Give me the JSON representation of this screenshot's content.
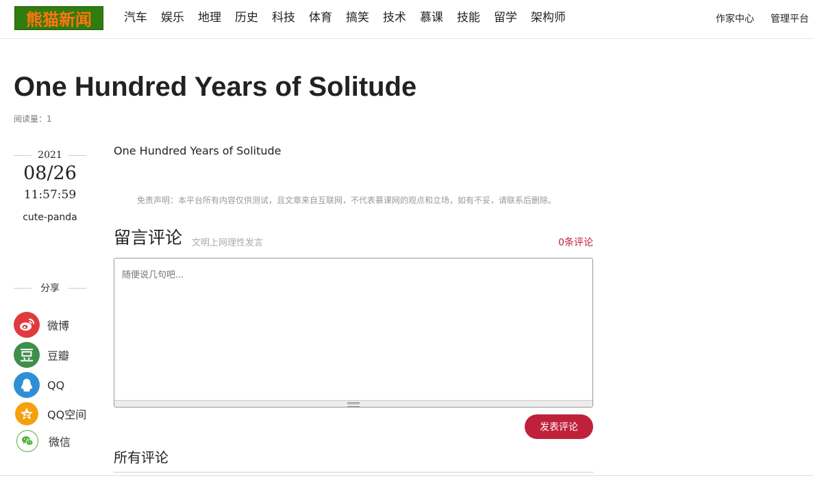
{
  "header": {
    "logo_text": "熊猫新闻",
    "nav": [
      {
        "label": "汽车"
      },
      {
        "label": "娱乐"
      },
      {
        "label": "地理"
      },
      {
        "label": "历史"
      },
      {
        "label": "科技"
      },
      {
        "label": "体育"
      },
      {
        "label": "搞笑"
      },
      {
        "label": "技术"
      },
      {
        "label": "慕课"
      },
      {
        "label": "技能"
      },
      {
        "label": "留学"
      },
      {
        "label": "架构师"
      }
    ],
    "author_center": "作家中心",
    "admin_platform": "管理平台"
  },
  "article": {
    "title": "One Hundred Years of Solitude",
    "read_count": "阅读量：1",
    "year": "2021",
    "date": "08/26",
    "time": "11:57:59",
    "author": "cute-panda",
    "body": "One Hundred Years of Solitude",
    "disclaimer": "免责声明：本平台所有内容仅供测试，且文章来自互联网，不代表慕课网的观点和立场，如有不妥，请联系后删除。"
  },
  "share": {
    "label": "分享",
    "items": [
      {
        "label": "微博",
        "icon": "weibo-icon",
        "color": "#e6162d"
      },
      {
        "label": "豆瓣",
        "icon": "douban-icon",
        "color": "#2e963d"
      },
      {
        "label": "QQ",
        "icon": "qq-icon",
        "color": "#2188d8"
      },
      {
        "label": "QQ空间",
        "icon": "qzone-icon",
        "color": "#f5a00f"
      },
      {
        "label": "微信",
        "icon": "wechat-icon",
        "color": "#4cb134"
      }
    ]
  },
  "comments": {
    "title": "留言评论",
    "subtitle": "文明上网理性发言",
    "count": "0条评论",
    "placeholder": "随便说几句吧...",
    "submit_label": "发表评论",
    "all_title": "所有评论"
  },
  "colors": {
    "accent": "#c0213a",
    "logo_bg": "#2f7d0f",
    "logo_text": "#f27a12"
  }
}
